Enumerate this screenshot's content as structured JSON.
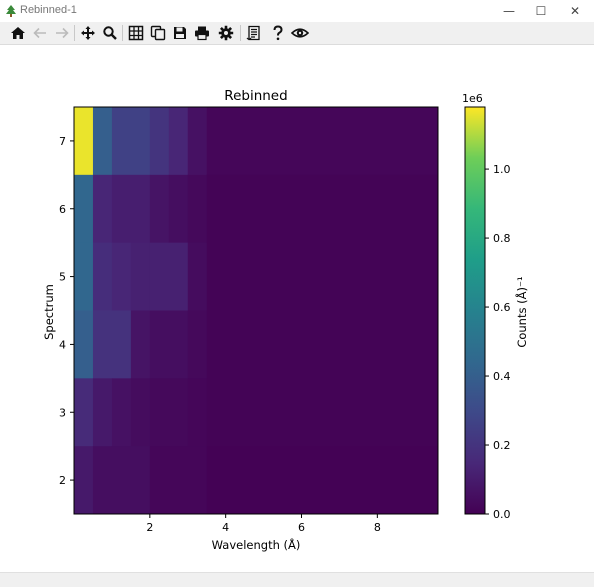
{
  "window": {
    "title": "Rebinned-1",
    "minimize_glyph": "—",
    "maximize_glyph": "☐",
    "close_glyph": "✕"
  },
  "toolbar": {
    "buttons": [
      "home-icon",
      "back-icon",
      "forward-icon",
      "pan-icon",
      "zoom-icon",
      "grid-icon",
      "copy-icon",
      "save-icon",
      "print-icon",
      "settings-icon",
      "script-icon",
      "help-icon",
      "view-icon"
    ]
  },
  "chart_data": {
    "type": "heatmap",
    "title": "Rebinned",
    "xlabel": "Wavelength (Å)",
    "ylabel": "Spectrum",
    "colorbar_label": "Counts (Å)⁻¹",
    "colorbar_exponent": "1e6",
    "colormap": "viridis",
    "xlim": [
      0.0,
      9.6
    ],
    "ylim": [
      1.5,
      7.5
    ],
    "x_ticks": [
      "2",
      "4",
      "6",
      "8"
    ],
    "y_ticks": [
      "2",
      "3",
      "4",
      "5",
      "6",
      "7"
    ],
    "colorbar_ticks": [
      "0.0",
      "0.2",
      "0.4",
      "0.6",
      "0.8",
      "1.0"
    ],
    "colorbar_range": [
      0,
      1.18
    ],
    "rows": [
      {
        "spectrum": 7,
        "y_range": [
          6.5,
          7.5
        ],
        "x_edges": [
          0.0,
          0.5,
          1.0,
          2.0,
          2.5,
          3.0,
          3.5,
          9.6
        ],
        "values": [
          1.16,
          0.4,
          0.26,
          0.2,
          0.14,
          0.06,
          0.02
        ]
      },
      {
        "spectrum": 6,
        "y_range": [
          5.5,
          6.5
        ],
        "x_edges": [
          0.0,
          0.5,
          1.0,
          2.0,
          2.5,
          3.0,
          3.5,
          9.6
        ],
        "values": [
          0.44,
          0.14,
          0.11,
          0.07,
          0.05,
          0.03,
          0.01
        ]
      },
      {
        "spectrum": 5,
        "y_range": [
          4.5,
          5.5
        ],
        "x_edges": [
          0.0,
          0.5,
          1.0,
          1.5,
          2.0,
          3.0,
          3.5,
          9.6
        ],
        "values": [
          0.44,
          0.17,
          0.14,
          0.12,
          0.12,
          0.04,
          0.01
        ]
      },
      {
        "spectrum": 4,
        "y_range": [
          3.5,
          4.5
        ],
        "x_edges": [
          0.0,
          0.5,
          1.5,
          2.0,
          3.0,
          3.5,
          9.6
        ],
        "values": [
          0.4,
          0.19,
          0.07,
          0.05,
          0.03,
          0.01
        ]
      },
      {
        "spectrum": 3,
        "y_range": [
          2.5,
          3.5
        ],
        "x_edges": [
          0.0,
          0.5,
          1.0,
          1.5,
          2.0,
          3.0,
          3.5,
          9.6
        ],
        "values": [
          0.16,
          0.09,
          0.06,
          0.04,
          0.03,
          0.02,
          0.01
        ]
      },
      {
        "spectrum": 2,
        "y_range": [
          1.5,
          2.5
        ],
        "x_edges": [
          0.0,
          0.5,
          2.0,
          3.5,
          9.6
        ],
        "values": [
          0.09,
          0.05,
          0.02,
          0.005
        ]
      }
    ]
  }
}
